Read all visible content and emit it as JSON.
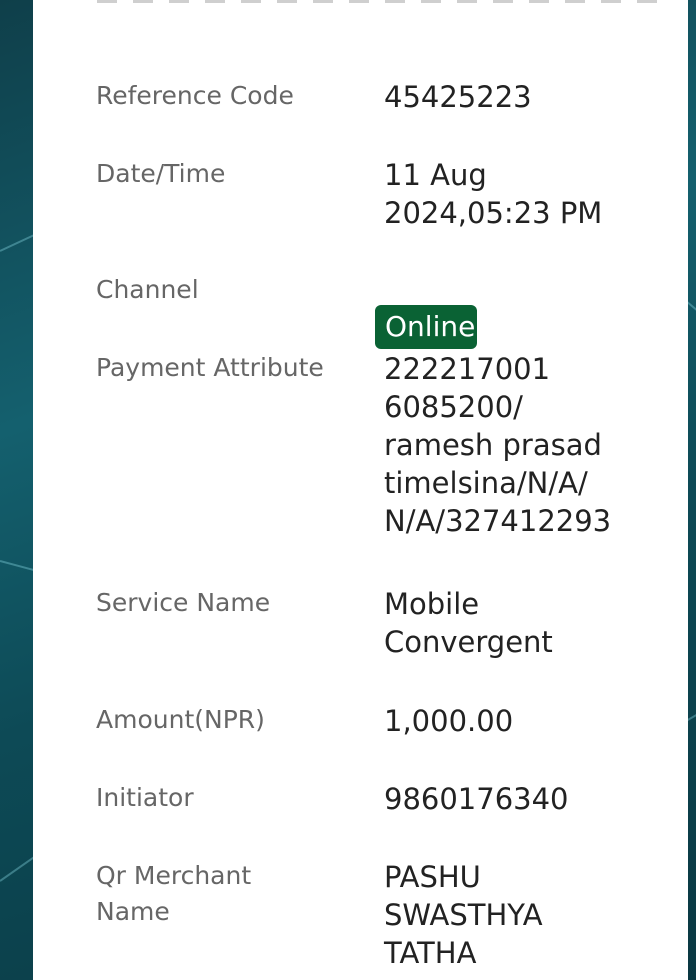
{
  "colors": {
    "card_background": "#ffffff",
    "label_text": "#666666",
    "value_text": "#222222",
    "channel_badge": "#0a6234",
    "page_background": "#14606e"
  },
  "details": {
    "reference_code": {
      "label": "Reference Code",
      "value": "45425223"
    },
    "date_time": {
      "label": "Date/Time",
      "value": "11 Aug\n2024,05:23 PM"
    },
    "channel": {
      "label": "Channel",
      "value": "Online"
    },
    "payment_attribute": {
      "label": "Payment Attribute",
      "value": "222217001\n6085200/\nramesh prasad\ntimelsina/N/A/\nN/A/327412293"
    },
    "service_name": {
      "label": "Service Name",
      "value": "Mobile\nConvergent"
    },
    "amount": {
      "label": "Amount(NPR)",
      "value": "1,000.00"
    },
    "initiator": {
      "label": "Initiator",
      "value": "9860176340"
    },
    "qr_merchant_name": {
      "label": "Qr Merchant\nName",
      "value": "PASHU\nSWASTHYA\nTATHA"
    }
  }
}
